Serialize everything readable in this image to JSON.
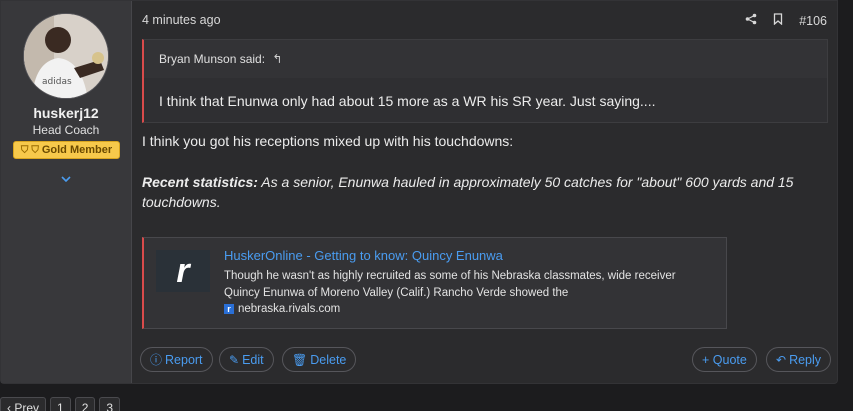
{
  "post": {
    "author": {
      "username": "huskerj12",
      "title": "Head Coach",
      "badge": "Gold Member",
      "avatar_shirt_text": "adidas"
    },
    "timestamp": "4 minutes ago",
    "post_number": "#106",
    "icons": {
      "share": "share-icon",
      "bookmark": "bookmark-icon",
      "expand": "chevron-down-icon"
    },
    "quote": {
      "author_said": "Bryan Munson said:",
      "text": "I think that Enunwa only had about 15 more as a WR his SR year. Just saying...."
    },
    "message": {
      "line1": "I think you got his receptions mixed up with his touchdowns:",
      "stats_label": "Recent statistics:",
      "stats_text": " As a senior, Enunwa hauled in approximately 50 catches for \"about\" 600 yards and 15 touchdowns."
    },
    "embed": {
      "title": "HuskerOnline - Getting to know: Quincy Enunwa",
      "description": "Though he wasn't as highly recruited as some of his Nebraska classmates, wide receiver Quincy Enunwa of Moreno Valley (Calif.) Rancho Verde showed the",
      "domain": "nebraska.rivals.com",
      "logo_letter": "r"
    },
    "actions": {
      "report": "Report",
      "edit": "Edit",
      "delete": "Delete",
      "quote": "+ Quote",
      "reply": "Reply"
    }
  },
  "pagination": {
    "prev": "Prev",
    "pages": [
      "1",
      "2",
      "3"
    ]
  },
  "colors": {
    "accent": "#4a9cf0",
    "quote_border": "#d94b4b",
    "badge": "#f7c94b"
  }
}
